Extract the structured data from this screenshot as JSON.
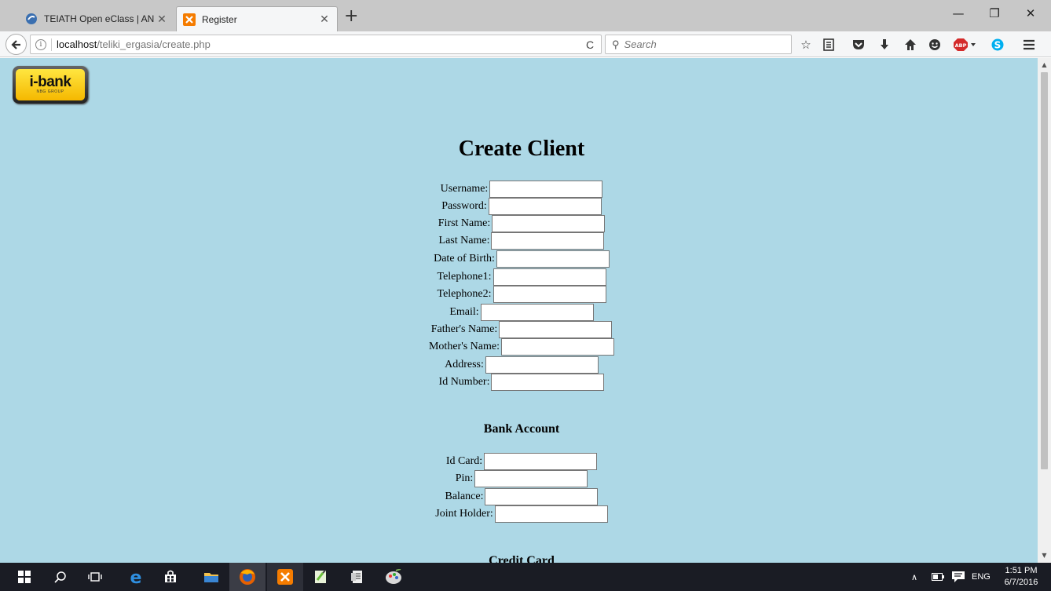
{
  "browser": {
    "tabs": [
      {
        "title": "TEIATH Open eClass | AN...",
        "active": false,
        "favicon": "eclass-icon"
      },
      {
        "title": "Register",
        "active": true,
        "favicon": "xampp-icon"
      }
    ],
    "url": {
      "host": "localhost",
      "path": "/teliki_ergasia/create.php"
    },
    "search_placeholder": "Search",
    "toolbar_icons": [
      "star-icon",
      "reading-list-icon",
      "pocket-icon",
      "download-icon",
      "home-icon",
      "smiley-icon",
      "adblock-icon",
      "skype-icon",
      "menu-icon"
    ],
    "adblock_label": "ABP"
  },
  "page": {
    "logo": {
      "text": "i-bank",
      "subtext": "NBG GROUP"
    },
    "title": "Create Client",
    "client_fields": [
      {
        "label": "Username:",
        "value": ""
      },
      {
        "label": "Password:",
        "value": ""
      },
      {
        "label": "First Name:",
        "value": ""
      },
      {
        "label": "Last Name:",
        "value": ""
      },
      {
        "label": "Date of Birth:",
        "value": ""
      },
      {
        "label": "Telephone1:",
        "value": ""
      },
      {
        "label": "Telephone2:",
        "value": ""
      },
      {
        "label": "Email:",
        "value": ""
      },
      {
        "label": "Father's Name:",
        "value": ""
      },
      {
        "label": "Mother's Name:",
        "value": ""
      },
      {
        "label": "Address:",
        "value": ""
      },
      {
        "label": "Id Number:",
        "value": ""
      }
    ],
    "bank_section": {
      "title": "Bank Account",
      "fields": [
        {
          "label": "Id Card:",
          "value": ""
        },
        {
          "label": "Pin:",
          "value": ""
        },
        {
          "label": "Balance:",
          "value": ""
        },
        {
          "label": "Joint Holder:",
          "value": ""
        }
      ]
    },
    "credit_section": {
      "title": "Credit Card"
    },
    "page_bg": "#add8e6"
  },
  "taskbar": {
    "apps": [
      "windows-start-icon",
      "search-icon",
      "task-view-icon",
      "edge-icon",
      "store-icon",
      "file-explorer-icon",
      "firefox-icon",
      "xampp-icon",
      "notepadpp-icon",
      "notes-icon",
      "paint-icon"
    ],
    "language": "ENG",
    "time": "1:51 PM",
    "date": "6/7/2016"
  }
}
